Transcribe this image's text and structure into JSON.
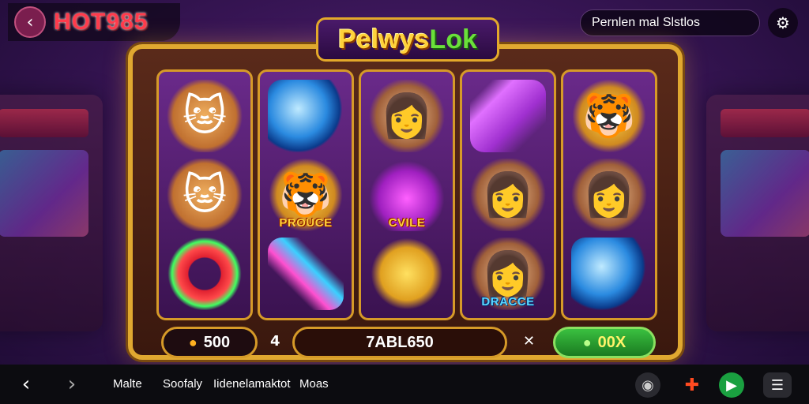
{
  "brand": {
    "name": "HOT985"
  },
  "search": {
    "text": "Pernlen mal Slstlos"
  },
  "game": {
    "title_main": "Pelwys",
    "title_accent": "Lok"
  },
  "reels": [
    [
      {
        "icon": "cat-cowboy-icon",
        "glyph": "🐱",
        "style": "cat",
        "label": ""
      },
      {
        "icon": "cat-cowboy-icon",
        "glyph": "🐱",
        "style": "cat",
        "label": ""
      },
      {
        "icon": "red-ring-icon",
        "glyph": "",
        "style": "ring",
        "label": ""
      }
    ],
    [
      {
        "icon": "blue-orb-icon",
        "glyph": "",
        "style": "orb",
        "label": ""
      },
      {
        "icon": "tiger-cat-icon",
        "glyph": "🐯",
        "style": "tiger",
        "label": "PROUCE"
      },
      {
        "icon": "bone-cross-icon",
        "glyph": "",
        "style": "bone",
        "label": ""
      }
    ],
    [
      {
        "icon": "cowgirl-icon",
        "glyph": "👩",
        "style": "girl",
        "label": ""
      },
      {
        "icon": "potion-icon",
        "glyph": "",
        "style": "potion",
        "label": "CVILE"
      },
      {
        "icon": "gold-treasure-icon",
        "glyph": "",
        "style": "gold",
        "label": ""
      }
    ],
    [
      {
        "icon": "purple-cube-icon",
        "glyph": "",
        "style": "cube",
        "label": ""
      },
      {
        "icon": "woman-portrait-icon",
        "glyph": "👩",
        "style": "girl",
        "label": ""
      },
      {
        "icon": "catwoman-icon",
        "glyph": "👩",
        "style": "girl",
        "label": "DRACCE"
      }
    ],
    [
      {
        "icon": "golden-tiger-icon",
        "glyph": "🐯",
        "style": "tiger",
        "label": ""
      },
      {
        "icon": "cowgirl-icon",
        "glyph": "👩",
        "style": "girl",
        "label": ""
      },
      {
        "icon": "blue-orb-icon",
        "glyph": "",
        "style": "orb",
        "label": ""
      }
    ]
  ],
  "controls": {
    "balance": "500",
    "bet": "7ABL650",
    "win": "00X",
    "op_left": "4",
    "op_right": "✕"
  },
  "nav": {
    "links": [
      "Malte",
      "Soofaly",
      "Iidenelamaktot",
      "Moas"
    ]
  },
  "colors": {
    "accent_gold": "#e0a830",
    "brand_red": "#ff3b4c",
    "spin_green": "#3ac040"
  }
}
